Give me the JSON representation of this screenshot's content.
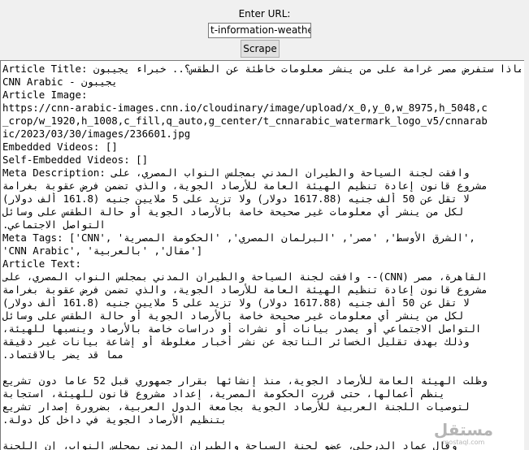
{
  "form": {
    "url_label": "Enter URL:",
    "url_value": "t-information-weather",
    "scrape_button": "Scrape"
  },
  "output_lines": [
    {
      "text": "Article Title: لماذا ستفرض مصر غرامة على من ينشر معلومات خاطئة عن الطقس؟.. خبراء يجيبون - CNN Arabic",
      "rtl": false
    },
    {
      "text": "يجيبون - CNN Arabic",
      "rtl": true
    },
    {
      "text": "Article Image:",
      "rtl": false
    },
    {
      "text": "https://cnn-arabic-images.cnn.io/cloudinary/image/upload/x_0,y_0,w_8975,h_5048,c",
      "rtl": false
    },
    {
      "text": "_crop/w_1920,h_1008,c_fill,q_auto,g_center/t_cnnarabic_watermark_logo_v5/cnnarab",
      "rtl": false
    },
    {
      "text": "ic/2023/03/30/images/236601.jpg",
      "rtl": false
    },
    {
      "text": "Embedded Videos: []",
      "rtl": false
    },
    {
      "text": "Self-Embedded Videos: []",
      "rtl": false
    },
    {
      "text": "Meta Description: وافقت لجنة السياحة والطيران المدني بمجلس النواب المصري، على",
      "rtl": false
    },
    {
      "text": "مشروع قانون إعادة تنظيم الهيئة العامة للأرصاد الجوية، والذي تضمن فرض عقوبة بغرامة",
      "rtl": true
    },
    {
      "text": "لا تقل عن 50 ألف جنيه (1617.88 دولار) ولا تزيد على 5 ملايين جنيه (161.8 ألف دولار)",
      "rtl": true
    },
    {
      "text": "لكل من ينشر أي معلومات غير صحيحة خاصة بالأرصاد الجوية أو حالة الطقس على وسائل",
      "rtl": true
    },
    {
      "text": "التواصل الاجتماعي.",
      "rtl": true
    },
    {
      "text": "Meta Tags: ['CNN', 'الشرق الأوسط', 'مصر', 'البرلمان المصري', 'الحكومة المصرية',",
      "rtl": false
    },
    {
      "text": "'CNN Arabic', 'مقال', 'بالعربية']",
      "rtl": true
    },
    {
      "text": "Article Text:",
      "rtl": false
    },
    {
      "text": "القاهرة، مصر (CNN)-- وافقت لجنة السياحة والطيران المدني بمجلس النواب المصري، على",
      "rtl": true
    },
    {
      "text": "مشروع قانون إعادة تنظيم الهيئة العامة للأرصاد الجوية، والذي تضمن فرض عقوبة بغرامة",
      "rtl": true
    },
    {
      "text": "لا تقل عن 50 ألف جنيه (1617.88 دولار) ولا تزيد على 5 ملايين جنيه (161.8 ألف دولار)",
      "rtl": true
    },
    {
      "text": "لكل من ينشر أي معلومات غير صحيحة خاصة بالأرصاد الجوية أو حالة الطقس على وسائل",
      "rtl": true
    },
    {
      "text": "التواصل الاجتماعي أو يصدر بيانات أو نشرات أو دراسات خاصة بالأرصاد وينسبها للهيئة،",
      "rtl": true
    },
    {
      "text": "وذلك بهدف تقليل الخسائر الناتجة عن نشر أخبار مغلوطة أو إشاعة بيانات غير دقيقة",
      "rtl": true
    },
    {
      "text": "مما قد يضر بالاقتصاد.",
      "rtl": true
    },
    {
      "text": "",
      "rtl": false
    },
    {
      "text": "وظلت الهيئة العامة للأرصاد الجوية، منذ إنشائها بقرار جمهوري قبل 52 عاما دون تشريع",
      "rtl": true
    },
    {
      "text": "ينظم أعمالها، حتى قررت الحكومة المصرية، إعداد مشروع قانون للهيئة، استجابة",
      "rtl": true
    },
    {
      "text": "لتوصيات اللجنة العربية للأرصاد الجوية بجامعة الدول العربية، بضرورة إصدار تشريع",
      "rtl": true
    },
    {
      "text": "بتنظيم الأرصاد الجوية في داخل كل دولة.",
      "rtl": true
    },
    {
      "text": "",
      "rtl": false
    },
    {
      "text": "وقال عماد الدرجلي، عضو لجنة السياحة والطيران المدني بمجلس النواب، إن اللجنة",
      "rtl": true
    }
  ],
  "watermark": {
    "arabic": "مستقل",
    "latin": "mostaql.com"
  }
}
